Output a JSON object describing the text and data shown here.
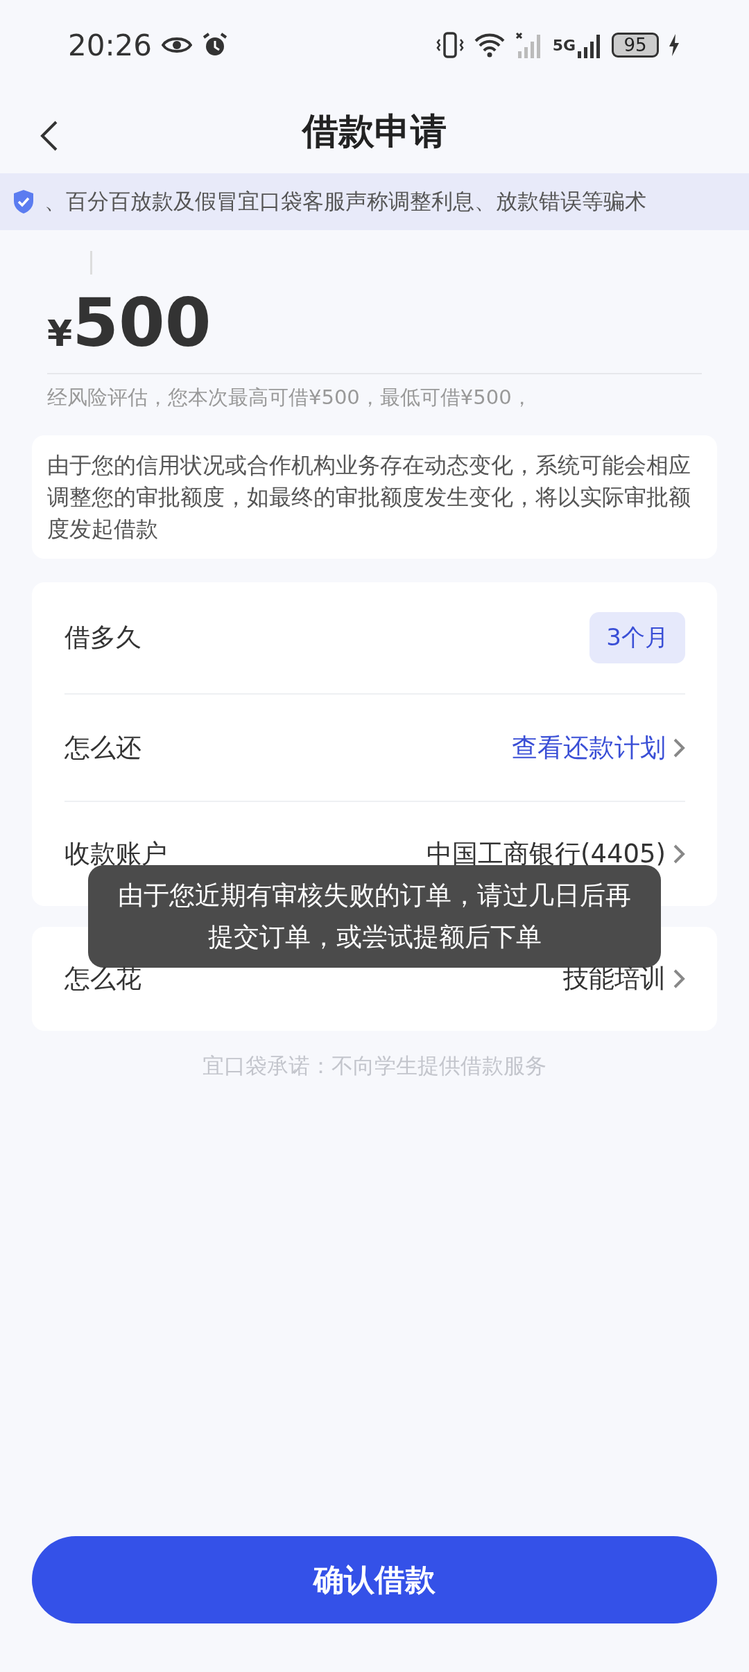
{
  "status_bar": {
    "time": "20:26",
    "network": "5G",
    "battery": "95"
  },
  "header": {
    "title": "借款申请"
  },
  "notice_banner": {
    "text": "、百分百放款及假冒宜口袋客服声称调整利息、放款错误等骗术"
  },
  "amount": {
    "currency": "¥",
    "value": "500",
    "hint": "经风险评估，您本次最高可借¥500，最低可借¥500，"
  },
  "disclaimer": "由于您的信用状况或合作机构业务存在动态变化，系统可能会相应调整您的审批额度，如最终的审批额度发生变化，将以实际审批额度发起借款",
  "rows": [
    {
      "kind": "chip",
      "label": "借多久",
      "value": "3个月"
    },
    {
      "kind": "link",
      "label": "怎么还",
      "value": "查看还款计划"
    },
    {
      "kind": "plain",
      "label": "收款账户",
      "value": "中国工商银行(4405)"
    }
  ],
  "purpose_row": {
    "kind": "plain",
    "label": "怎么花",
    "value": "技能培训"
  },
  "promise": "宜口袋承诺：不向学生提供借款服务",
  "toast": "由于您近期有审核失败的订单，请过几日后再提交订单，或尝试提额后下单",
  "confirm_button": "确认借款"
}
